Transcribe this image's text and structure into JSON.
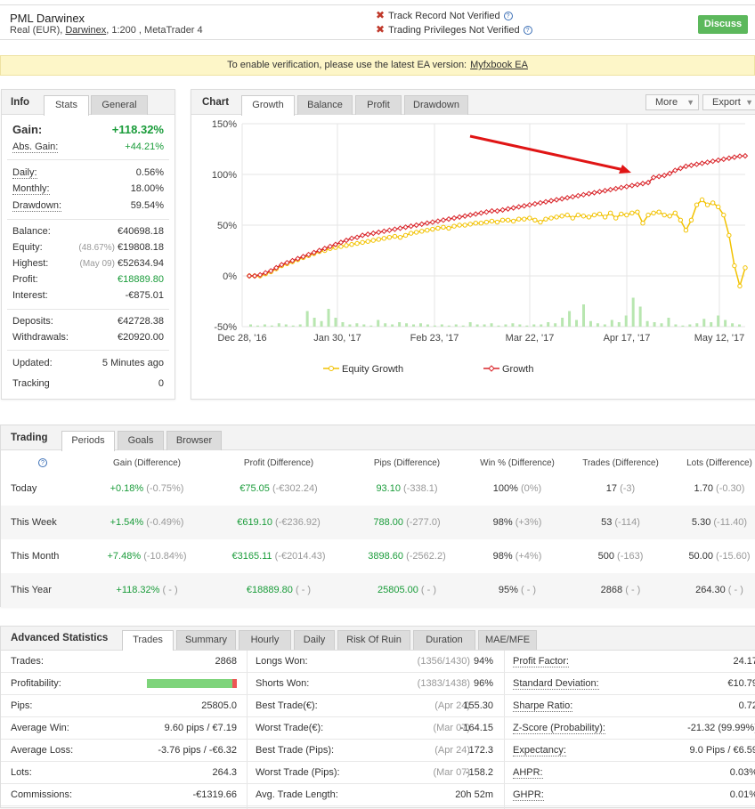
{
  "header": {
    "account_name": "PML Darwinex",
    "account_type": "Real (EUR),",
    "broker": "Darwinex",
    "account_details": ", 1:200 , MetaTrader 4",
    "track_record": "Track Record Not Verified",
    "trading_privileges": "Trading Privileges Not Verified",
    "discuss_label": "Discuss"
  },
  "banner": {
    "text": "To enable verification, please use the latest EA version:",
    "link": "Myfxbook EA"
  },
  "info": {
    "title": "Info",
    "tabs": [
      "Stats",
      "General"
    ],
    "gain_label": "Gain:",
    "gain_value": "+118.32%",
    "abs_gain_label": "Abs. Gain:",
    "abs_gain_value": "+44.21%",
    "daily_label": "Daily:",
    "daily_value": "0.56%",
    "monthly_label": "Monthly:",
    "monthly_value": "18.00%",
    "drawdown_label": "Drawdown:",
    "drawdown_value": "59.54%",
    "balance_label": "Balance:",
    "balance_value": "€40698.18",
    "equity_label": "Equity:",
    "equity_note": "(48.67%)",
    "equity_value": "€19808.18",
    "highest_label": "Highest:",
    "highest_note": "(May 09)",
    "highest_value": "€52634.94",
    "profit_label": "Profit:",
    "profit_value": "€18889.80",
    "interest_label": "Interest:",
    "interest_value": "-€875.01",
    "deposits_label": "Deposits:",
    "deposits_value": "€42728.38",
    "withdrawals_label": "Withdrawals:",
    "withdrawals_value": "€20920.00",
    "updated_label": "Updated:",
    "updated_value": "5 Minutes ago",
    "tracking_label": "Tracking",
    "tracking_value": "0"
  },
  "chart": {
    "title": "Chart",
    "tabs": [
      "Growth",
      "Balance",
      "Profit",
      "Drawdown"
    ],
    "more_label": "More",
    "export_label": "Export",
    "colors": {
      "equity": "#f2c200",
      "growth": "#d9262b",
      "bars": "#b8e6b0",
      "arrow": "#e01515"
    }
  },
  "chart_data": {
    "type": "line",
    "ylim": [
      -50,
      150
    ],
    "yticks": [
      "150%",
      "100%",
      "50%",
      "0%",
      "-50%"
    ],
    "xticks": [
      "Dec 28, '16",
      "Jan 30, '17",
      "Feb 23, '17",
      "Mar 22, '17",
      "Apr 17, '17",
      "May 12, '17"
    ],
    "grid": true,
    "legend_position": "bottom",
    "series": [
      {
        "name": "Equity Growth",
        "values": [
          0,
          0,
          0,
          2,
          4,
          7,
          10,
          12,
          14,
          16,
          18,
          20,
          22,
          24,
          25,
          27,
          28,
          29,
          30,
          31,
          32,
          33,
          34,
          35,
          36,
          37,
          38,
          39,
          38,
          40,
          42,
          43,
          44,
          45,
          46,
          47,
          48,
          47,
          49,
          50,
          50,
          51,
          52,
          52,
          53,
          54,
          53,
          55,
          55,
          54,
          56,
          56,
          57,
          55,
          53,
          56,
          57,
          58,
          59,
          60,
          57,
          60,
          59,
          58,
          60,
          61,
          58,
          62,
          57,
          61,
          60,
          62,
          63,
          52,
          60,
          62,
          63,
          60,
          59,
          62,
          55,
          45,
          55,
          70,
          75,
          70,
          72,
          68,
          60,
          40,
          10,
          -10,
          8
        ]
      },
      {
        "name": "Growth",
        "values": [
          0,
          0,
          1,
          3,
          5,
          8,
          11,
          13,
          15,
          17,
          19,
          21,
          23,
          25,
          27,
          29,
          31,
          33,
          35,
          37,
          38,
          40,
          41,
          42,
          43,
          44,
          45,
          46,
          47,
          48,
          49,
          50,
          51,
          52,
          53,
          54,
          55,
          56,
          57,
          58,
          59,
          60,
          61,
          62,
          63,
          64,
          64,
          65,
          66,
          67,
          68,
          69,
          70,
          71,
          72,
          73,
          74,
          75,
          76,
          77,
          78,
          79,
          80,
          81,
          82,
          83,
          84,
          85,
          86,
          87,
          88,
          89,
          90,
          91,
          92,
          97,
          98,
          99,
          101,
          104,
          106,
          108,
          109,
          110,
          111,
          112,
          113,
          114,
          115,
          116,
          117,
          118,
          118.3
        ]
      }
    ],
    "volume_bars": [
      2,
      1,
      2,
      1,
      3,
      2,
      1,
      2,
      14,
      8,
      5,
      16,
      8,
      4,
      2,
      3,
      2,
      1,
      6,
      3,
      2,
      4,
      3,
      2,
      3,
      2,
      1,
      2,
      1,
      2,
      1,
      4,
      2,
      2,
      3,
      1,
      2,
      3,
      2,
      1,
      2,
      2,
      4,
      3,
      8,
      14,
      6,
      20,
      5,
      3,
      2,
      6,
      4,
      10,
      26,
      18,
      5,
      4,
      3,
      8,
      2,
      1,
      2,
      3,
      7,
      4,
      10,
      6,
      3,
      2
    ]
  },
  "trading": {
    "title": "Trading",
    "tabs": [
      "Periods",
      "Goals",
      "Browser"
    ],
    "headers": [
      "Gain (Difference)",
      "Profit (Difference)",
      "Pips (Difference)",
      "Win % (Difference)",
      "Trades (Difference)",
      "Lots (Difference)"
    ],
    "rows": [
      {
        "period": "Today",
        "gain": "+0.18%",
        "gain_diff": "(-0.75%)",
        "profit": "€75.05",
        "profit_diff": "(-€302.24)",
        "pips": "93.10",
        "pips_diff": "(-338.1)",
        "win": "100%",
        "win_diff": "(0%)",
        "trades": "17",
        "trades_diff": "(-3)",
        "lots": "1.70",
        "lots_diff": "(-0.30)"
      },
      {
        "period": "This Week",
        "gain": "+1.54%",
        "gain_diff": "(-0.49%)",
        "profit": "€619.10",
        "profit_diff": "(-€236.92)",
        "pips": "788.00",
        "pips_diff": "(-277.0)",
        "win": "98%",
        "win_diff": "(+3%)",
        "trades": "53",
        "trades_diff": "(-114)",
        "lots": "5.30",
        "lots_diff": "(-11.40)"
      },
      {
        "period": "This Month",
        "gain": "+7.48%",
        "gain_diff": "(-10.84%)",
        "profit": "€3165.11",
        "profit_diff": "(-€2014.43)",
        "pips": "3898.60",
        "pips_diff": "(-2562.2)",
        "win": "98%",
        "win_diff": "(+4%)",
        "trades": "500",
        "trades_diff": "(-163)",
        "lots": "50.00",
        "lots_diff": "(-15.60)"
      },
      {
        "period": "This Year",
        "gain": "+118.32%",
        "gain_diff": "( - )",
        "profit": "€18889.80",
        "profit_diff": "( - )",
        "pips": "25805.00",
        "pips_diff": "( - )",
        "win": "95%",
        "win_diff": "( - )",
        "trades": "2868",
        "trades_diff": "( - )",
        "lots": "264.30",
        "lots_diff": "( - )"
      }
    ]
  },
  "advanced": {
    "title": "Advanced Statistics",
    "tabs": [
      "Trades",
      "Summary",
      "Hourly",
      "Daily",
      "Risk Of Ruin",
      "Duration",
      "MAE/MFE"
    ],
    "col1": [
      {
        "label": "Trades:",
        "value": "2868"
      },
      {
        "label": "Profitability:",
        "value": ""
      },
      {
        "label": "Pips:",
        "value": "25805.0"
      },
      {
        "label": "Average Win:",
        "value": "9.60 pips / €7.19"
      },
      {
        "label": "Average Loss:",
        "value": "-3.76 pips / -€6.32"
      },
      {
        "label": "Lots:",
        "value": "264.3"
      },
      {
        "label": "Commissions:",
        "value": "-€1319.66"
      }
    ],
    "profitability_fraction": 0.95,
    "col2": [
      {
        "label": "Longs Won:",
        "note": "(1356/1430)",
        "value": "94%"
      },
      {
        "label": "Shorts Won:",
        "note": "(1383/1438)",
        "value": "96%"
      },
      {
        "label": "Best Trade(€):",
        "note": "(Apr 24)",
        "value": "155.30"
      },
      {
        "label": "Worst Trade(€):",
        "note": "(Mar 07)",
        "value": "-164.15"
      },
      {
        "label": "Best Trade (Pips):",
        "note": "(Apr 24)",
        "value": "172.3"
      },
      {
        "label": "Worst Trade (Pips):",
        "note": "(Mar 07)",
        "value": "-158.2"
      },
      {
        "label": "Avg. Trade Length:",
        "note": "",
        "value": "20h 52m"
      }
    ],
    "col3": [
      {
        "label": "Profit Factor:",
        "value": "24.17"
      },
      {
        "label": "Standard Deviation:",
        "value": "€10.79"
      },
      {
        "label": "Sharpe Ratio:",
        "value": "0.72"
      },
      {
        "label": "Z-Score (Probability):",
        "value": "-21.32 (99.99%)"
      },
      {
        "label": "Expectancy:",
        "value": "9.0 Pips / €6.59"
      },
      {
        "label": "AHPR:",
        "value": "0.03%"
      },
      {
        "label": "GHPR:",
        "value": "0.01%"
      }
    ]
  }
}
